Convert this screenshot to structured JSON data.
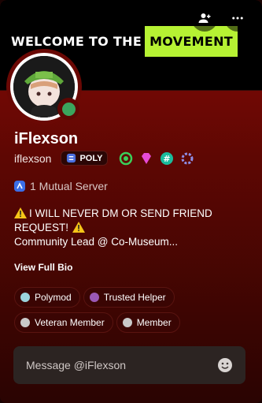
{
  "banner": {
    "text": "WELCOME TO THE",
    "highlight": "MOVEMENT"
  },
  "header_actions": {
    "add_friend_icon": "add-friend-icon",
    "more_icon": "more-icon"
  },
  "profile": {
    "display_name": "iFlexson",
    "username": "iflexson",
    "server_tag": "POLY",
    "status_color": "#3ba55d",
    "badges": [
      {
        "icon": "green-hypesquad-icon",
        "color": "#3ad05a"
      },
      {
        "icon": "pink-gem-icon",
        "color": "#e64bd6"
      },
      {
        "icon": "hashtag-badge-icon",
        "color": "#1abc9c"
      },
      {
        "icon": "nitro-badge-icon",
        "color": "#8f8fe8"
      }
    ]
  },
  "mutual": {
    "text": "1 Mutual Server"
  },
  "bio": {
    "line1": "I WILL NEVER DM OR SEND FRIEND REQUEST!",
    "line2": "Community Lead @ Co-Museum..."
  },
  "view_full_bio": "View Full Bio",
  "roles": [
    {
      "label": "Polymod",
      "color": "#9bd4dd"
    },
    {
      "label": "Trusted Helper",
      "color": "#9b59b6"
    },
    {
      "label": "Veteran Member",
      "color": "#c9c9c9"
    },
    {
      "label": "Member",
      "color": "#c9c9c9"
    }
  ],
  "message_input": {
    "placeholder": "Message @iFlexson"
  }
}
